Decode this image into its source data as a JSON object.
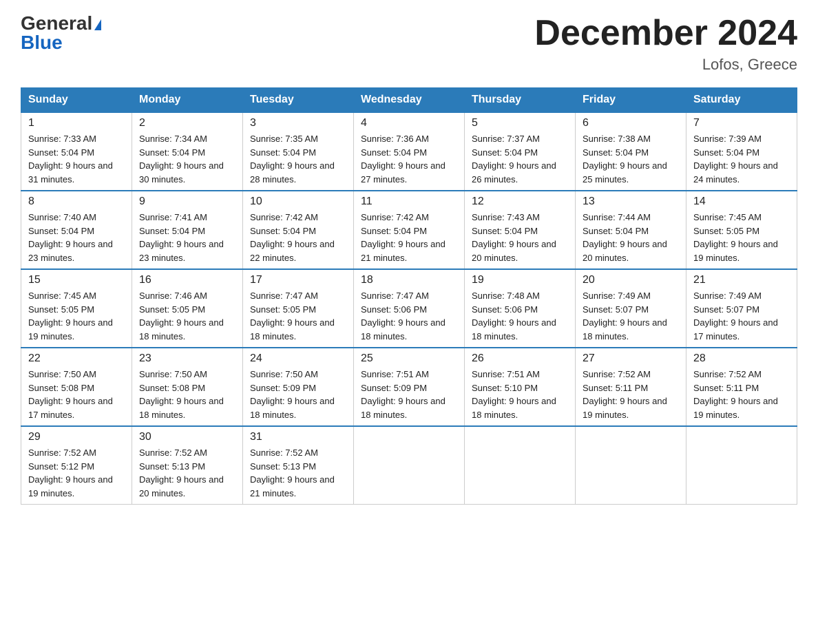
{
  "header": {
    "logo_general": "General",
    "logo_triangle": "▲",
    "logo_blue": "Blue",
    "month_title": "December 2024",
    "location": "Lofos, Greece"
  },
  "columns": [
    "Sunday",
    "Monday",
    "Tuesday",
    "Wednesday",
    "Thursday",
    "Friday",
    "Saturday"
  ],
  "weeks": [
    [
      {
        "day": "1",
        "sunrise": "7:33 AM",
        "sunset": "5:04 PM",
        "daylight": "9 hours and 31 minutes."
      },
      {
        "day": "2",
        "sunrise": "7:34 AM",
        "sunset": "5:04 PM",
        "daylight": "9 hours and 30 minutes."
      },
      {
        "day": "3",
        "sunrise": "7:35 AM",
        "sunset": "5:04 PM",
        "daylight": "9 hours and 28 minutes."
      },
      {
        "day": "4",
        "sunrise": "7:36 AM",
        "sunset": "5:04 PM",
        "daylight": "9 hours and 27 minutes."
      },
      {
        "day": "5",
        "sunrise": "7:37 AM",
        "sunset": "5:04 PM",
        "daylight": "9 hours and 26 minutes."
      },
      {
        "day": "6",
        "sunrise": "7:38 AM",
        "sunset": "5:04 PM",
        "daylight": "9 hours and 25 minutes."
      },
      {
        "day": "7",
        "sunrise": "7:39 AM",
        "sunset": "5:04 PM",
        "daylight": "9 hours and 24 minutes."
      }
    ],
    [
      {
        "day": "8",
        "sunrise": "7:40 AM",
        "sunset": "5:04 PM",
        "daylight": "9 hours and 23 minutes."
      },
      {
        "day": "9",
        "sunrise": "7:41 AM",
        "sunset": "5:04 PM",
        "daylight": "9 hours and 23 minutes."
      },
      {
        "day": "10",
        "sunrise": "7:42 AM",
        "sunset": "5:04 PM",
        "daylight": "9 hours and 22 minutes."
      },
      {
        "day": "11",
        "sunrise": "7:42 AM",
        "sunset": "5:04 PM",
        "daylight": "9 hours and 21 minutes."
      },
      {
        "day": "12",
        "sunrise": "7:43 AM",
        "sunset": "5:04 PM",
        "daylight": "9 hours and 20 minutes."
      },
      {
        "day": "13",
        "sunrise": "7:44 AM",
        "sunset": "5:04 PM",
        "daylight": "9 hours and 20 minutes."
      },
      {
        "day": "14",
        "sunrise": "7:45 AM",
        "sunset": "5:05 PM",
        "daylight": "9 hours and 19 minutes."
      }
    ],
    [
      {
        "day": "15",
        "sunrise": "7:45 AM",
        "sunset": "5:05 PM",
        "daylight": "9 hours and 19 minutes."
      },
      {
        "day": "16",
        "sunrise": "7:46 AM",
        "sunset": "5:05 PM",
        "daylight": "9 hours and 18 minutes."
      },
      {
        "day": "17",
        "sunrise": "7:47 AM",
        "sunset": "5:05 PM",
        "daylight": "9 hours and 18 minutes."
      },
      {
        "day": "18",
        "sunrise": "7:47 AM",
        "sunset": "5:06 PM",
        "daylight": "9 hours and 18 minutes."
      },
      {
        "day": "19",
        "sunrise": "7:48 AM",
        "sunset": "5:06 PM",
        "daylight": "9 hours and 18 minutes."
      },
      {
        "day": "20",
        "sunrise": "7:49 AM",
        "sunset": "5:07 PM",
        "daylight": "9 hours and 18 minutes."
      },
      {
        "day": "21",
        "sunrise": "7:49 AM",
        "sunset": "5:07 PM",
        "daylight": "9 hours and 17 minutes."
      }
    ],
    [
      {
        "day": "22",
        "sunrise": "7:50 AM",
        "sunset": "5:08 PM",
        "daylight": "9 hours and 17 minutes."
      },
      {
        "day": "23",
        "sunrise": "7:50 AM",
        "sunset": "5:08 PM",
        "daylight": "9 hours and 18 minutes."
      },
      {
        "day": "24",
        "sunrise": "7:50 AM",
        "sunset": "5:09 PM",
        "daylight": "9 hours and 18 minutes."
      },
      {
        "day": "25",
        "sunrise": "7:51 AM",
        "sunset": "5:09 PM",
        "daylight": "9 hours and 18 minutes."
      },
      {
        "day": "26",
        "sunrise": "7:51 AM",
        "sunset": "5:10 PM",
        "daylight": "9 hours and 18 minutes."
      },
      {
        "day": "27",
        "sunrise": "7:52 AM",
        "sunset": "5:11 PM",
        "daylight": "9 hours and 19 minutes."
      },
      {
        "day": "28",
        "sunrise": "7:52 AM",
        "sunset": "5:11 PM",
        "daylight": "9 hours and 19 minutes."
      }
    ],
    [
      {
        "day": "29",
        "sunrise": "7:52 AM",
        "sunset": "5:12 PM",
        "daylight": "9 hours and 19 minutes."
      },
      {
        "day": "30",
        "sunrise": "7:52 AM",
        "sunset": "5:13 PM",
        "daylight": "9 hours and 20 minutes."
      },
      {
        "day": "31",
        "sunrise": "7:52 AM",
        "sunset": "5:13 PM",
        "daylight": "9 hours and 21 minutes."
      },
      null,
      null,
      null,
      null
    ]
  ]
}
